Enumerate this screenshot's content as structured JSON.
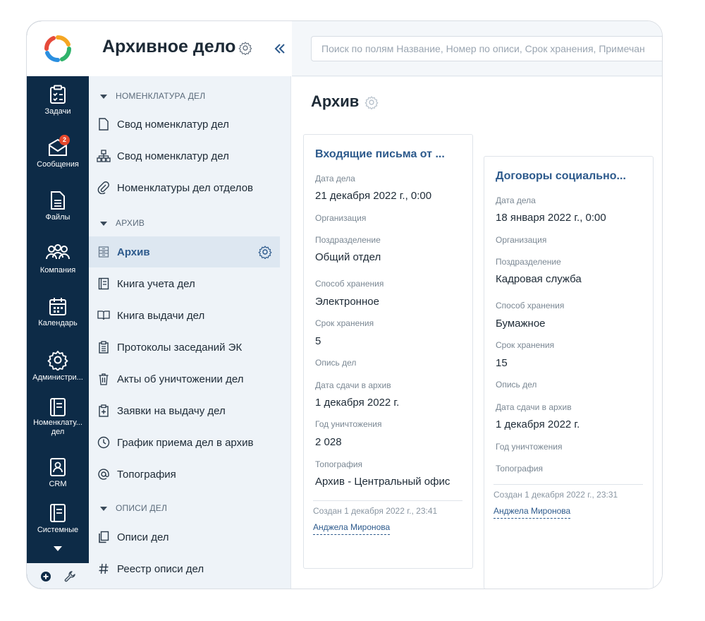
{
  "rail": {
    "items": [
      {
        "label": "Задачи",
        "icon": "tasks-icon"
      },
      {
        "label": "Сообщения",
        "icon": "messages-icon",
        "badge": "2"
      },
      {
        "label": "Файлы",
        "icon": "files-icon"
      },
      {
        "label": "Компания",
        "icon": "company-icon"
      },
      {
        "label": "Календарь",
        "icon": "calendar-icon"
      },
      {
        "label": "Администри...",
        "icon": "admin-icon"
      },
      {
        "label": "Номенклату...",
        "label2": "дел",
        "icon": "nomenclature-icon"
      },
      {
        "label": "CRM",
        "icon": "crm-icon"
      },
      {
        "label": "Системные",
        "icon": "system-icon"
      }
    ]
  },
  "nav": {
    "title": "Архивное дело",
    "sections": [
      {
        "label": "НОМЕНКЛАТУРА ДЕЛ"
      },
      {
        "label": "АРХИВ"
      },
      {
        "label": "ОПИСИ ДЕЛ"
      }
    ],
    "items": [
      {
        "label": "Свод номенклатур дел",
        "icon": "document-icon"
      },
      {
        "label": "Свод номенклатур дел",
        "icon": "hierarchy-icon"
      },
      {
        "label": "Номенклатуры дел отделов",
        "icon": "paperclip-icon"
      },
      {
        "label": "Архив",
        "icon": "archive-icon",
        "active": true
      },
      {
        "label": "Книга учета дел",
        "icon": "ledger-icon"
      },
      {
        "label": "Книга выдачи дел",
        "icon": "open-book-icon"
      },
      {
        "label": "Протоколы заседаний ЭК",
        "icon": "clipboard-icon"
      },
      {
        "label": "Акты об уничтожении дел",
        "icon": "trash-icon"
      },
      {
        "label": "Заявки на выдачу дел",
        "icon": "request-icon"
      },
      {
        "label": "График приема дел в архив",
        "icon": "clock-icon"
      },
      {
        "label": "Топография",
        "icon": "at-icon"
      },
      {
        "label": "Описи дел",
        "icon": "copies-icon"
      },
      {
        "label": "Реестр описи дел",
        "icon": "hash-icon"
      }
    ]
  },
  "search": {
    "placeholder": "Поиск по полям Название, Номер по описи, Срок хранения, Примечан"
  },
  "page": {
    "title": "Архив"
  },
  "cards": [
    {
      "title": "Входящие письма от ...",
      "fields": [
        {
          "label": "Дата дела",
          "value": "21 декабря 2022 г., 0:00"
        },
        {
          "label": "Организация",
          "value": ""
        },
        {
          "label": "Поздразделение",
          "value": "Общий отдел"
        },
        {
          "label": "Способ хранения",
          "value": "Электронное"
        },
        {
          "label": "Срок хранения",
          "value": "5"
        },
        {
          "label": "Опись дел",
          "value": ""
        },
        {
          "label": "Дата сдачи в архив",
          "value": "1 декабря 2022 г."
        },
        {
          "label": "Год уничтожения",
          "value": "2 028"
        },
        {
          "label": "Топография",
          "value": "Архив - Центральный офис"
        }
      ],
      "created": "Создан  1 декабря 2022 г., 23:41",
      "author": "Анджела Миронова"
    },
    {
      "title": "Договоры социально...",
      "fields": [
        {
          "label": "Дата дела",
          "value": "18 января 2022 г., 0:00"
        },
        {
          "label": "Организация",
          "value": ""
        },
        {
          "label": "Поздразделение",
          "value": "Кадровая служба"
        },
        {
          "label": "Способ хранения",
          "value": "Бумажное"
        },
        {
          "label": "Срок хранения",
          "value": "15"
        },
        {
          "label": "Опись дел",
          "value": ""
        },
        {
          "label": "Дата сдачи в архив",
          "value": "1 декабря 2022 г."
        },
        {
          "label": "Год уничтожения",
          "value": ""
        },
        {
          "label": "Топография",
          "value": ""
        }
      ],
      "created": "Создан  1 декабря 2022 г., 23:31",
      "author": "Анджела Миронова"
    }
  ],
  "colors": {
    "rail": "#0d2b47",
    "accent": "#2d5a8c",
    "badge": "#e5482c"
  }
}
